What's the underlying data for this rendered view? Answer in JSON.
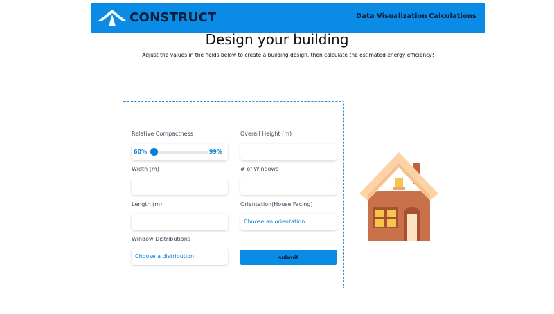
{
  "header": {
    "logo_text": "CONSTRUCT",
    "nav": [
      "Data Visualization",
      "Calculations"
    ]
  },
  "page": {
    "title": "Design your building",
    "subtitle": "Adjust the values in the fields below to create a building design, then calculate the estimated energy efficiency!"
  },
  "form": {
    "relative_compactness": {
      "label": "Relative Compactness",
      "min_label": "60%",
      "max_label": "99%",
      "value": 0
    },
    "overall_height": {
      "label": "Overall Height (m)",
      "value": ""
    },
    "width": {
      "label": "Width (m)",
      "value": ""
    },
    "num_windows": {
      "label": "# of Windows",
      "value": ""
    },
    "length": {
      "label": "Length (m)",
      "value": ""
    },
    "orientation": {
      "label": "Orientation(House Facing)",
      "selected": "Choose an orientation:"
    },
    "window_distributions": {
      "label": "Window Distributions",
      "selected": "Choose a distribution:"
    },
    "submit_label": "submit"
  },
  "colors": {
    "brand_blue": "#0a8ce6",
    "accent_blue": "#0a7fd6",
    "navy": "#0b1e3a"
  },
  "icons": [
    "logo-roof-icon",
    "house-icon"
  ]
}
